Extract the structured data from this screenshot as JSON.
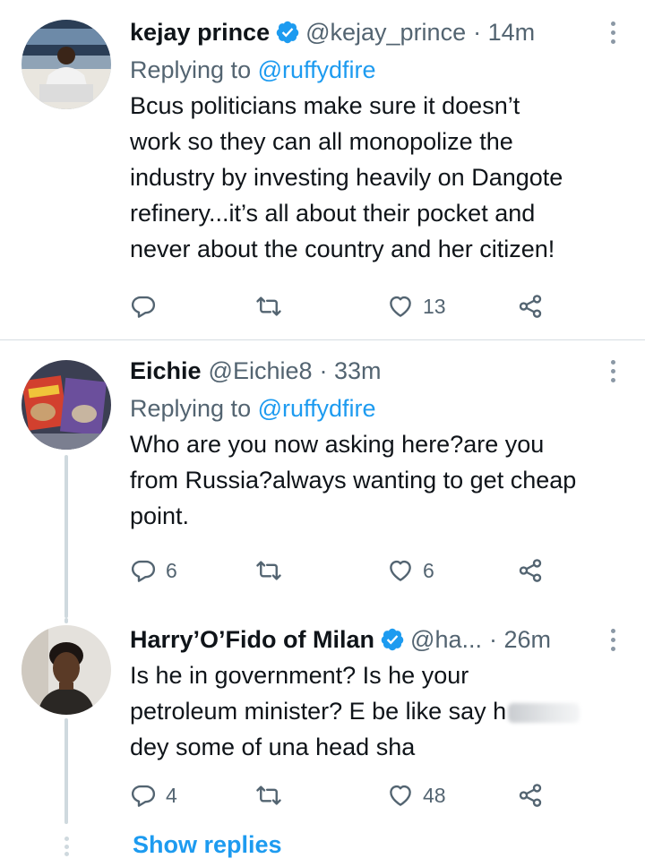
{
  "tweets": [
    {
      "name": "kejay prince",
      "verified": true,
      "handle": "@kejay_prince",
      "time": "· 14m",
      "replying_prefix": "Replying to ",
      "replying_to": "@ruffydfire",
      "lines": [
        "Bcus politicians make sure it doesn’t",
        "work so they can all monopolize the",
        "industry by investing heavily on Dangote",
        "refinery...it’s all about their pocket and",
        "never about the country and her citizen!"
      ],
      "reply_count": "",
      "retweet_count": "",
      "like_count": "13"
    },
    {
      "name": "Eichie",
      "verified": false,
      "handle": "@Eichie8",
      "time": "· 33m",
      "replying_prefix": "Replying to ",
      "replying_to": "@ruffydfire",
      "lines": [
        "Who are you now asking here?are you",
        "from Russia?always wanting to get cheap",
        "point."
      ],
      "reply_count": "6",
      "retweet_count": "",
      "like_count": "6"
    },
    {
      "name": "Harry’O’Fido of Milan",
      "verified": true,
      "handle": "@ha...",
      "time": "· 26m",
      "lines": [
        "Is he in government? Is he your",
        "petroleum minister? E be like say h",
        "dey some of una head sha"
      ],
      "reply_count": "4",
      "retweet_count": "",
      "like_count": "48"
    }
  ],
  "show_replies": "Show replies",
  "icons": {
    "reply": "reply-icon",
    "retweet": "retweet-icon",
    "like": "heart-icon",
    "share": "share-icon",
    "more": "more-options-icon",
    "verified": "verified-badge-icon"
  },
  "colors": {
    "accent": "#1d9bf0",
    "text": "#0f1419",
    "secondary": "#536471",
    "icon": "#536471",
    "divider": "#d6dde2",
    "thread_line": "#cfd9de"
  }
}
